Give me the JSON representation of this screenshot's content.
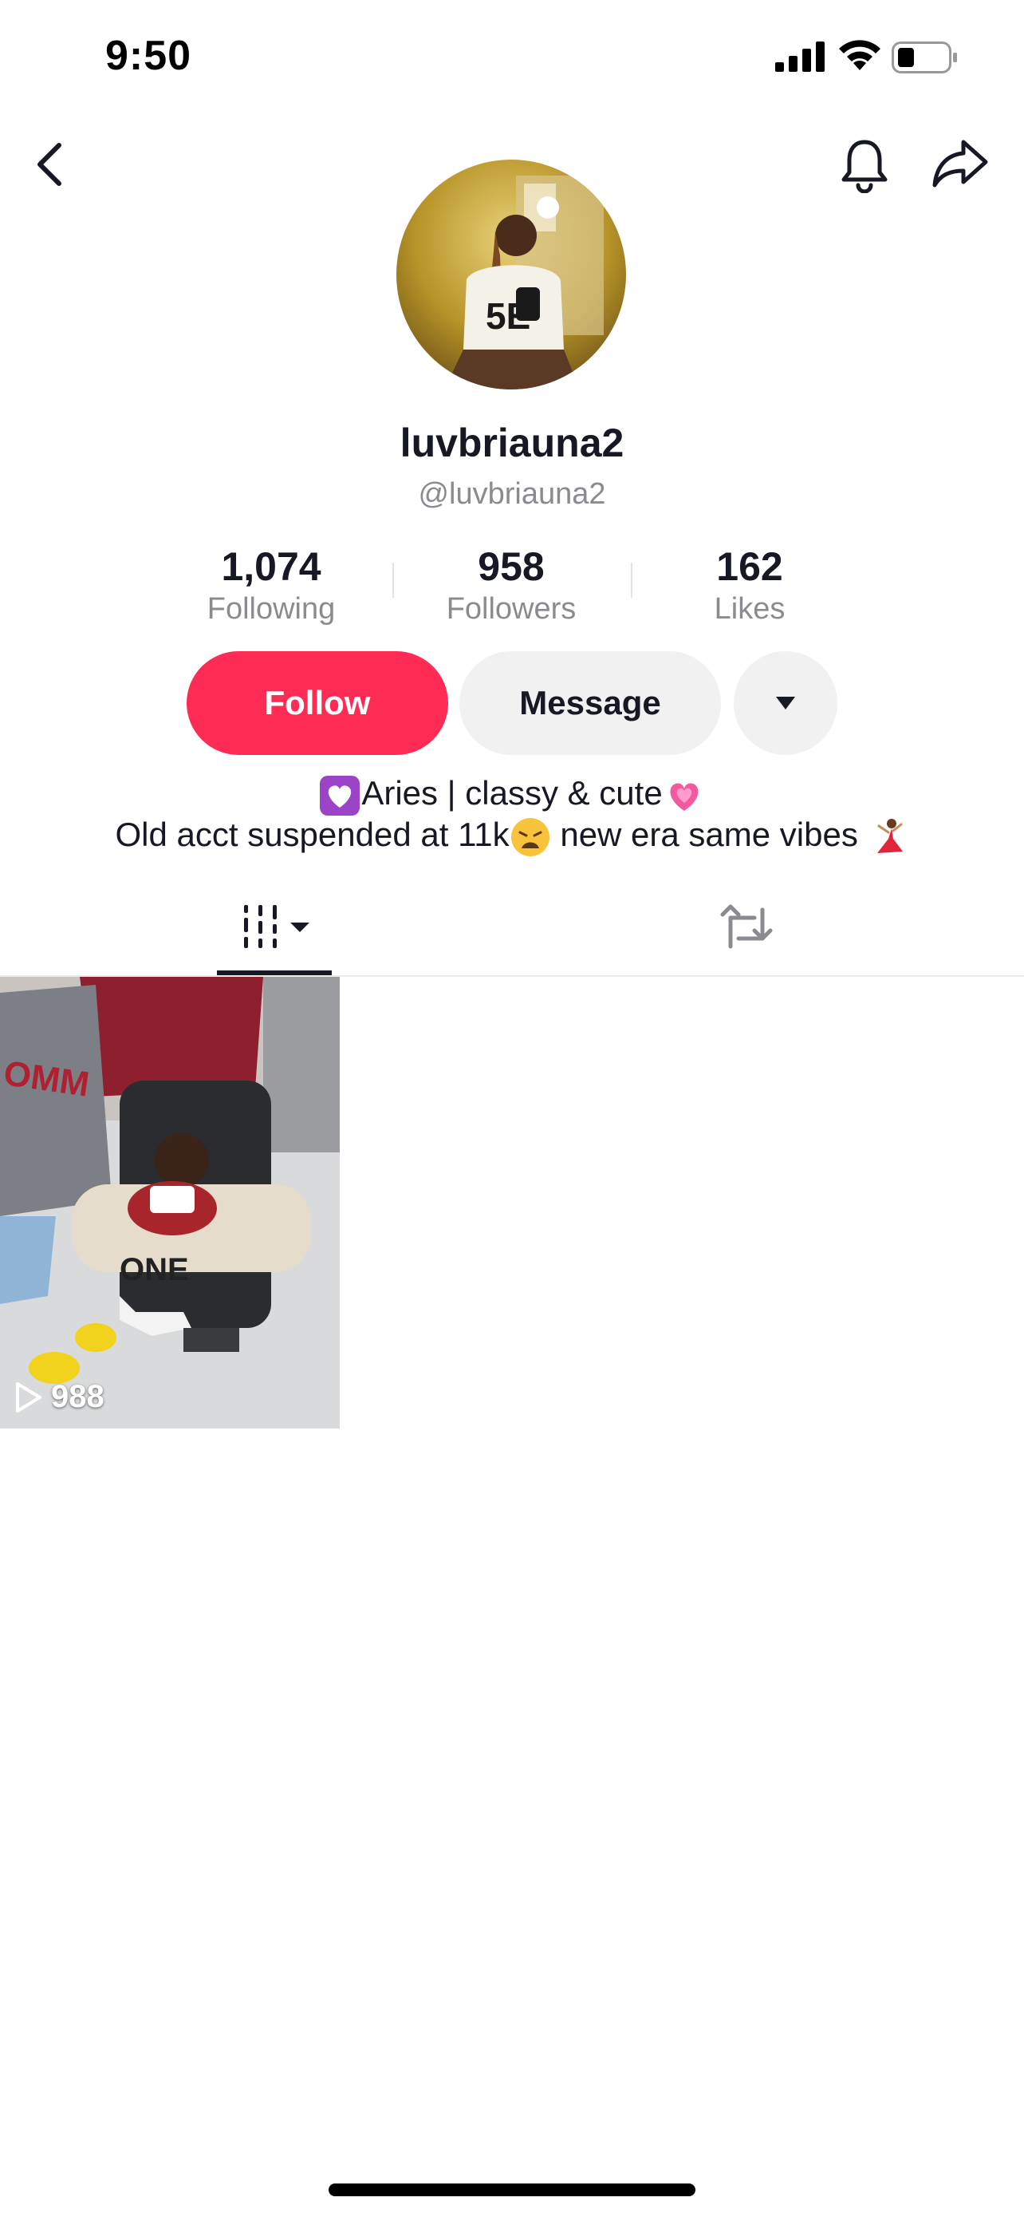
{
  "status_bar": {
    "time": "9:50"
  },
  "profile": {
    "display_name": "luvbriauna2",
    "handle": "@luvbriauna2",
    "stats": [
      {
        "value": "1,074",
        "label": "Following"
      },
      {
        "value": "958",
        "label": "Followers"
      },
      {
        "value": "162",
        "label": "Likes"
      }
    ],
    "bio_line1_text": "Aries | classy & cute",
    "bio_line2_text_a": "Old acct suspended at 11k",
    "bio_line2_text_b": " new era same vibes "
  },
  "actions": {
    "follow_label": "Follow",
    "message_label": "Message"
  },
  "videos": [
    {
      "views": "988"
    }
  ],
  "colors": {
    "accent": "#fe2c55",
    "secondary_button": "#f1f1f2",
    "muted_text": "#8a8b91"
  }
}
